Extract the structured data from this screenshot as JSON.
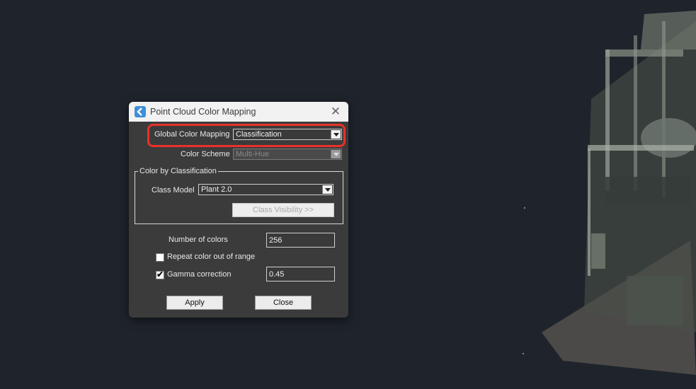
{
  "dialog": {
    "title": "Point Cloud Color Mapping",
    "close_glyph": "✕",
    "global_color_mapping": {
      "label": "Global Color Mapping",
      "value": "Classification"
    },
    "color_scheme": {
      "label": "Color Scheme",
      "value": "Multi-Hue",
      "enabled": false
    },
    "color_by_classification": {
      "title": "Color by Classification",
      "class_model": {
        "label": "Class Model",
        "value": "Plant 2.0"
      },
      "class_visibility_button": "Class Visibility >>"
    },
    "number_of_colors": {
      "label": "Number of colors",
      "value": "256"
    },
    "repeat_color": {
      "label": "Repeat color out of range",
      "checked": false
    },
    "gamma_correction": {
      "label": "Gamma correction",
      "checked": true,
      "value": "0.45",
      "check_glyph": "✔"
    },
    "apply_button": "Apply",
    "close_button": "Close"
  },
  "icons": {
    "app": "autocad-back-arrow-icon",
    "close": "close-icon",
    "dropdown": "chevron-down-icon"
  },
  "colors": {
    "highlight": "#e8322a",
    "background": "#1f242c",
    "dialog": "#3b3b3b",
    "titlebar": "#f2f2f2"
  }
}
